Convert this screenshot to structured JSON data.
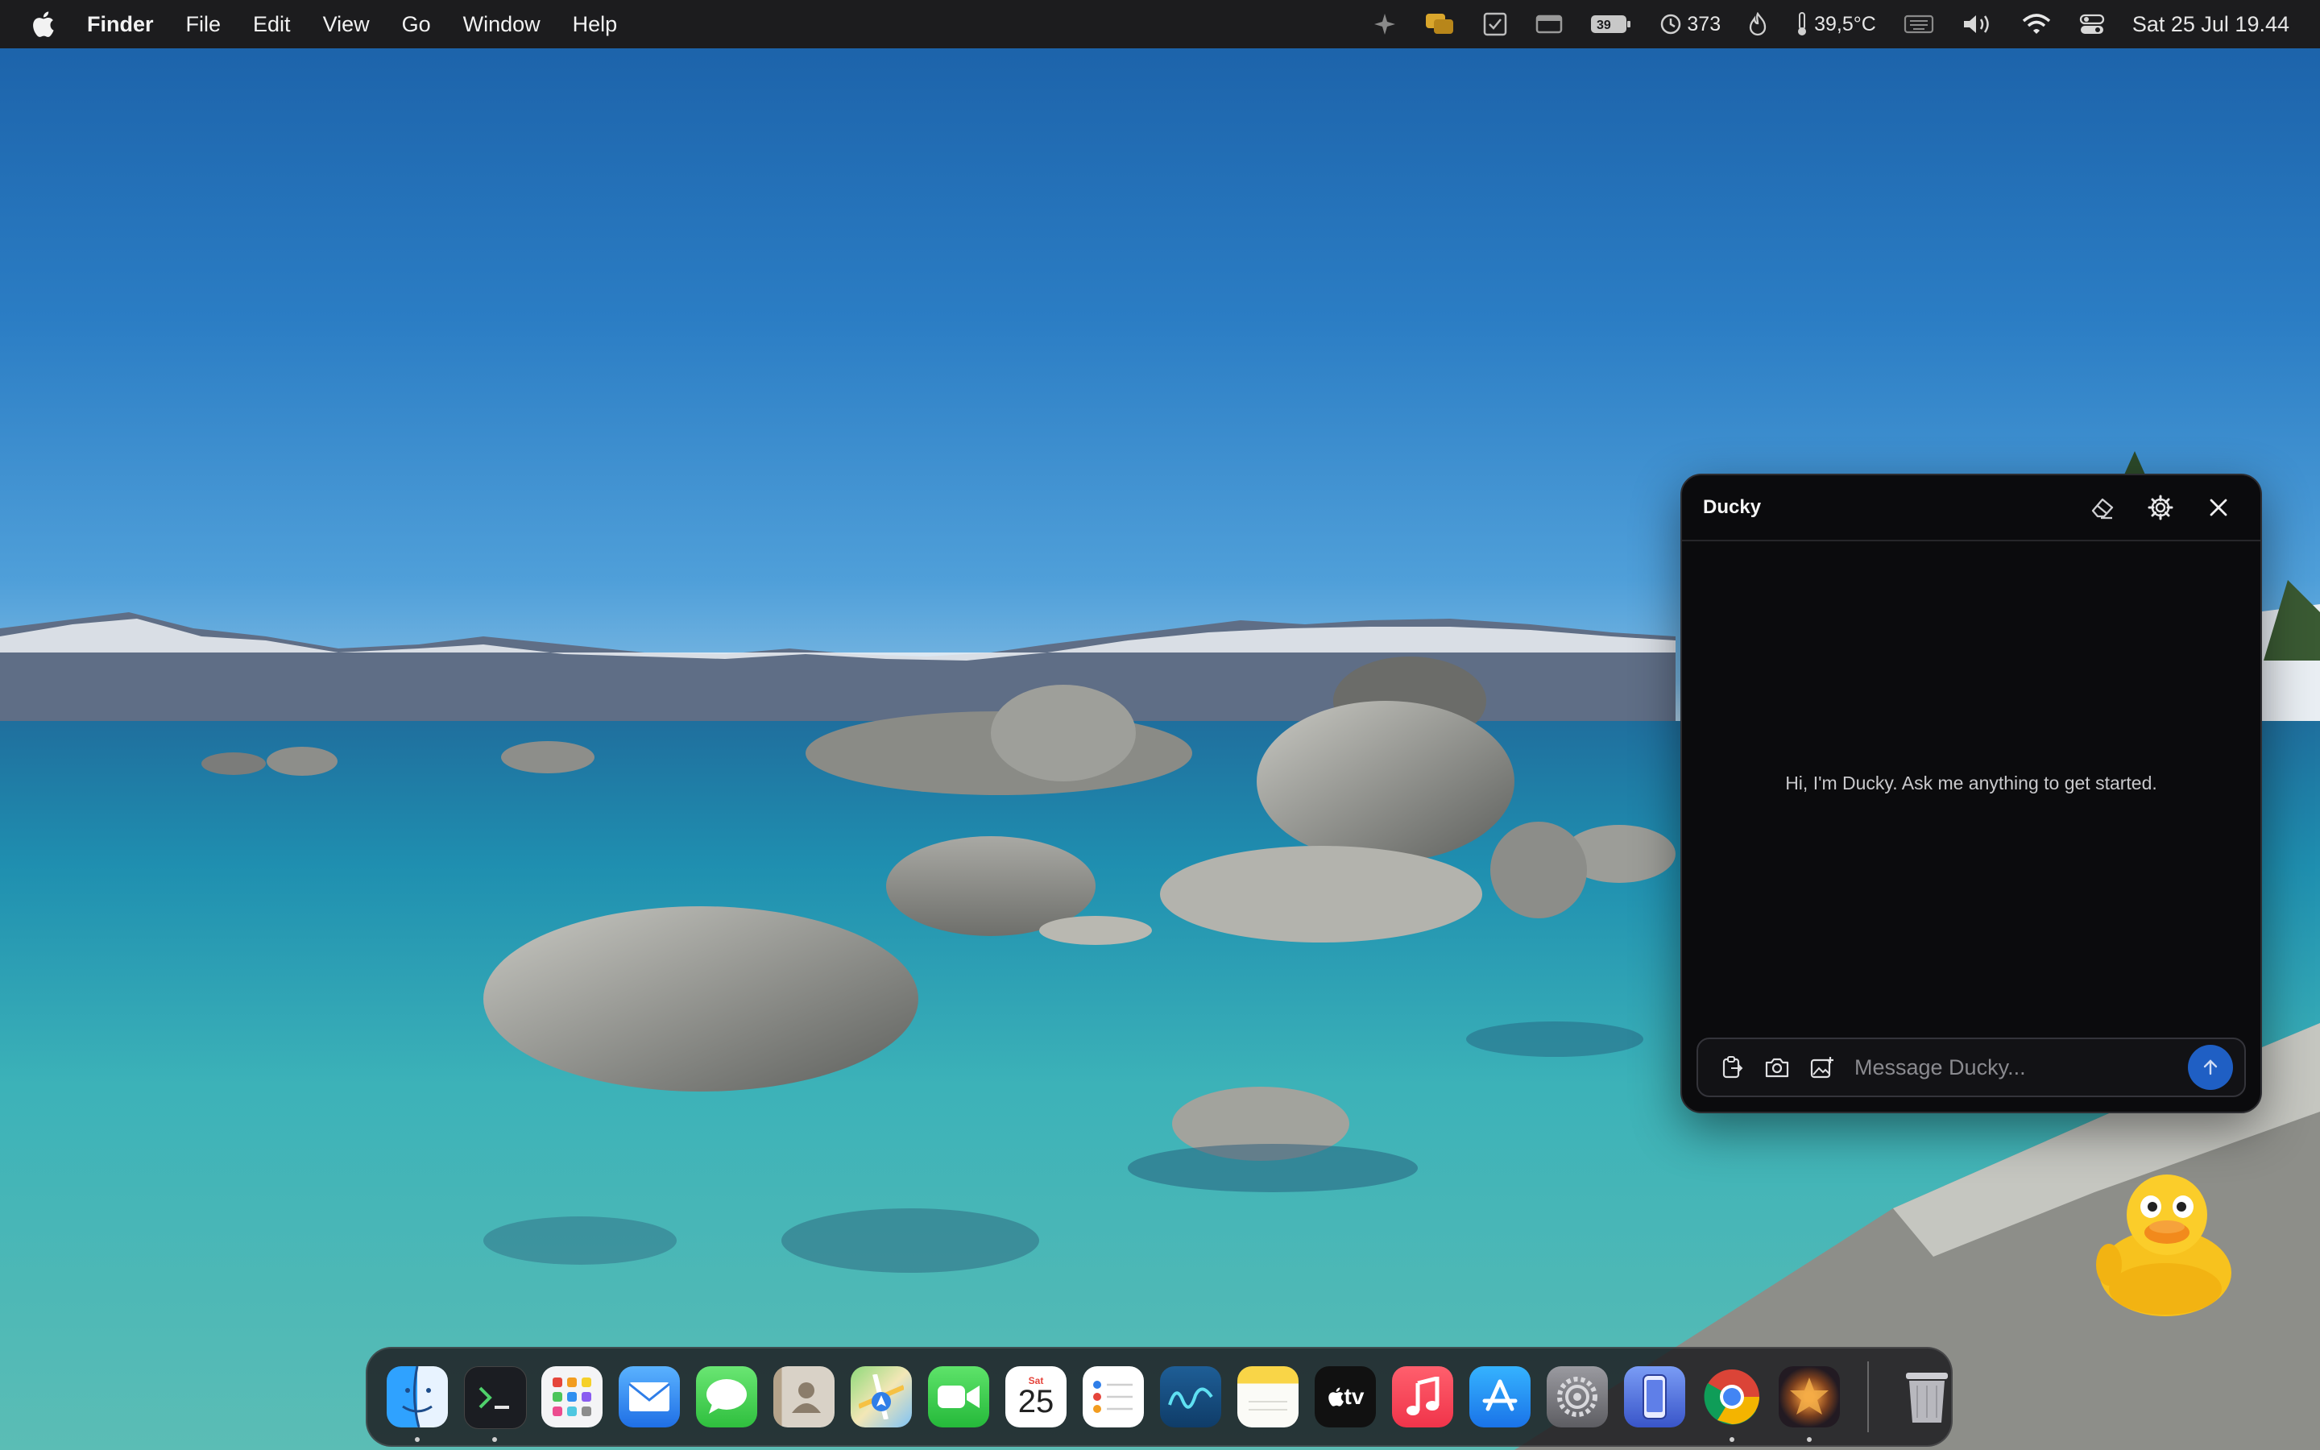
{
  "menubar": {
    "app_name": "Finder",
    "menus": [
      "File",
      "Edit",
      "View",
      "Go",
      "Window",
      "Help"
    ],
    "status": {
      "battery_percent": "39",
      "activity_count": "373",
      "temperature": "39,5°C",
      "datetime": "Sat 25 Jul  19.44"
    }
  },
  "chat": {
    "title": "Ducky",
    "greeting": "Hi, I'm Ducky. Ask me anything to get started.",
    "input_placeholder": "Message Ducky..."
  },
  "dock": {
    "calendar_day": "Sat",
    "calendar_date": "25",
    "tv_label": "tv",
    "apps": [
      "Finder",
      "Terminal",
      "Launchpad",
      "Mail",
      "Messages",
      "Contacts",
      "Maps",
      "FaceTime",
      "Calendar",
      "Reminders",
      "Freeform",
      "Notes",
      "TV",
      "Music",
      "App Store",
      "System Settings",
      "iPhone Mirroring",
      "Google Chrome",
      "Game",
      "Trash"
    ]
  },
  "colors": {
    "menubar_bg": "#1c1c1e",
    "chat_bg": "#0b0b0d",
    "send_button": "#1f5fc4"
  }
}
